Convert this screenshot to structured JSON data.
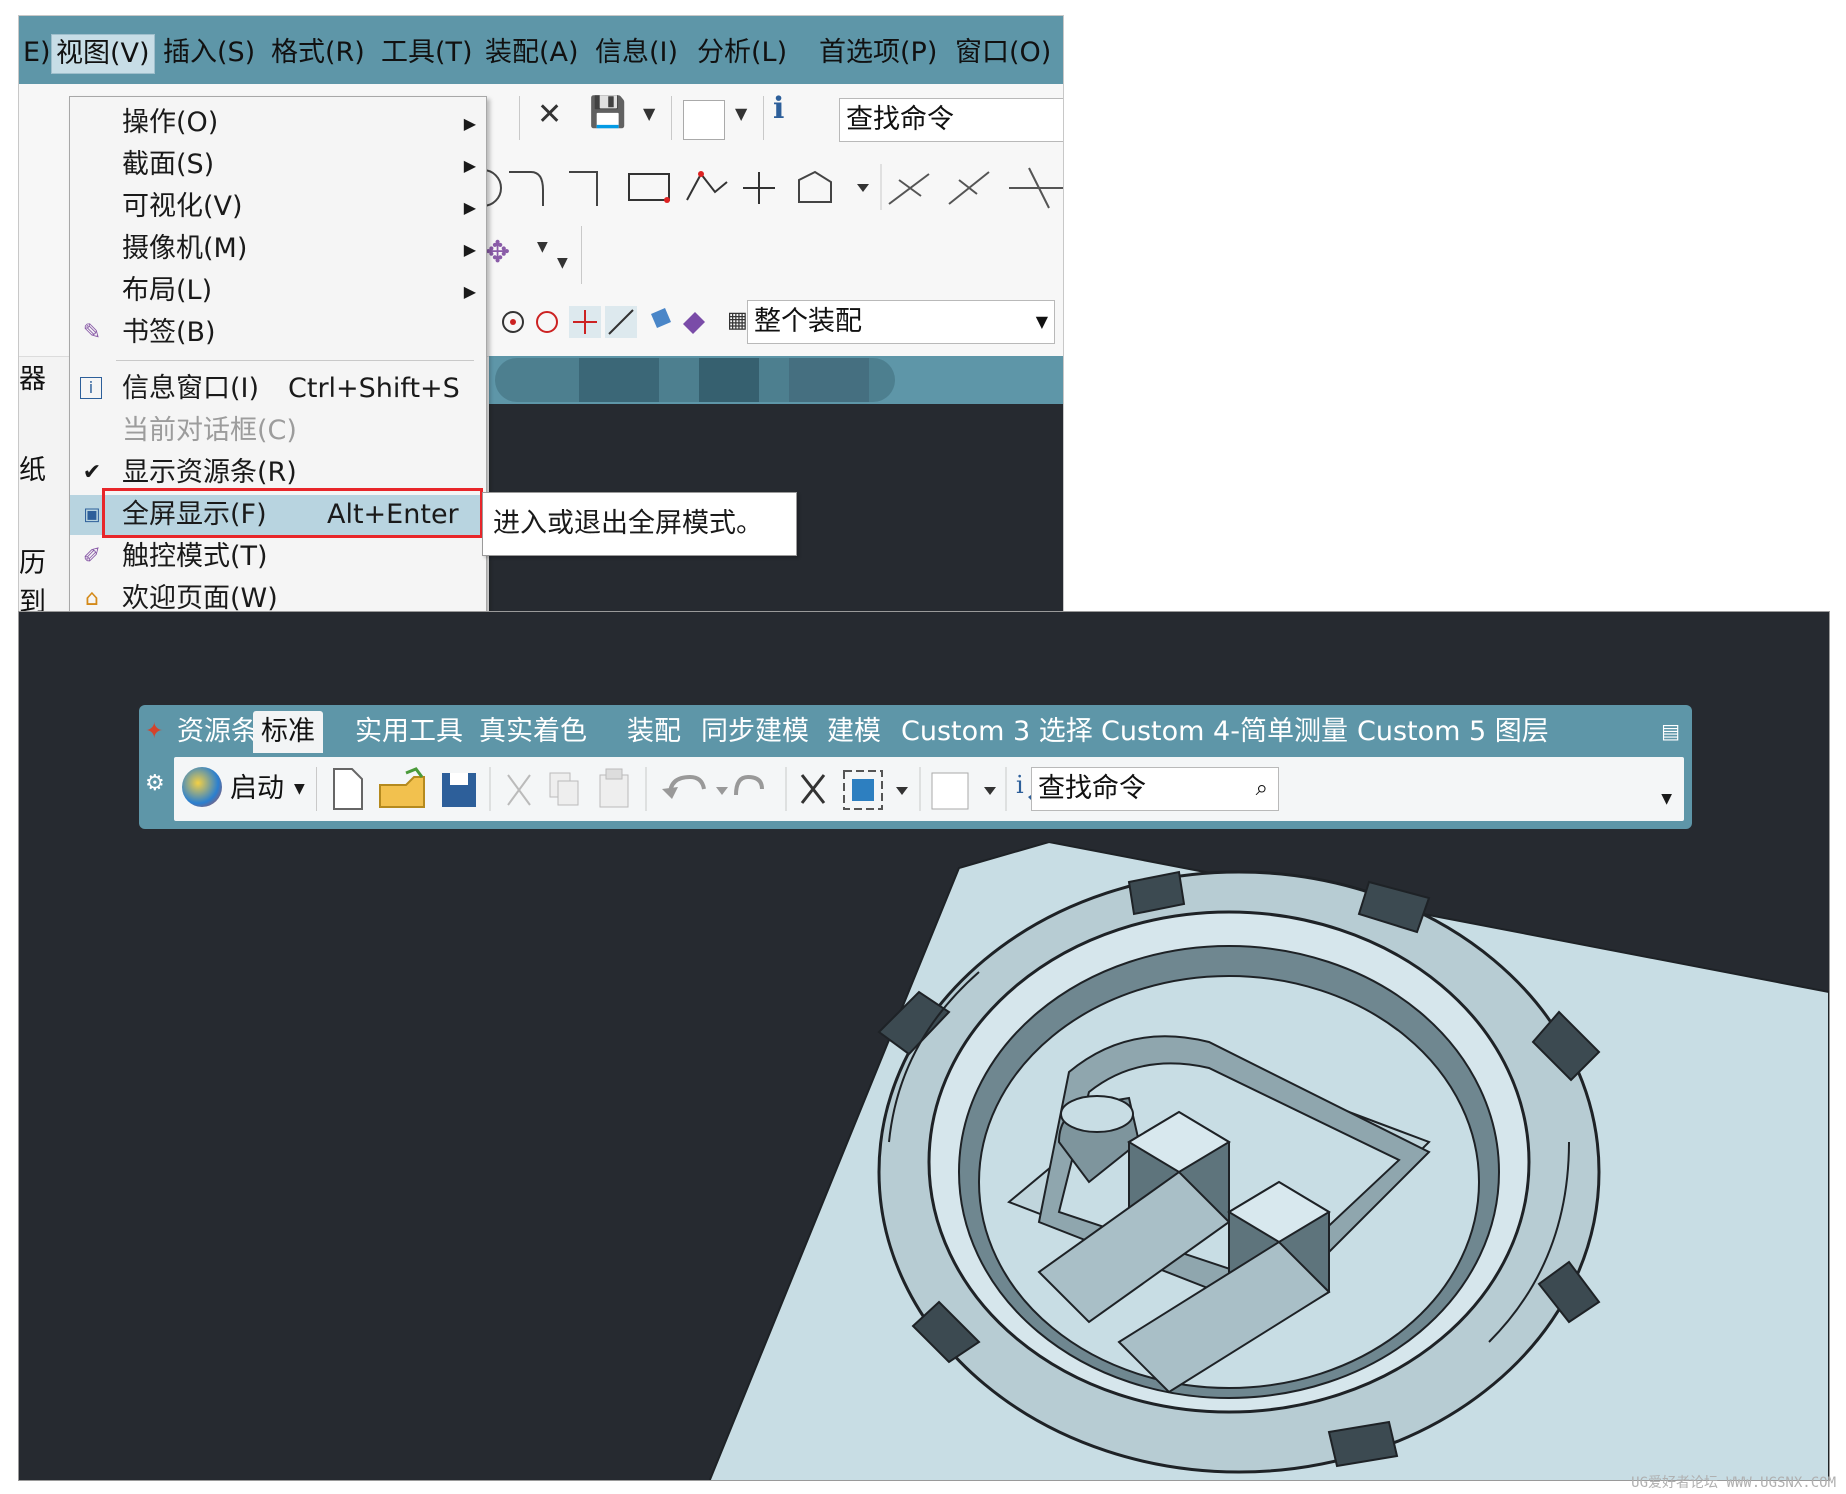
{
  "top_screenshot": {
    "menubar": {
      "items": [
        "E)",
        "视图(V)",
        "插入(S)",
        "格式(R)",
        "工具(T)",
        "装配(A)",
        "信息(I)",
        "分析(L)",
        "首选项(P)",
        "窗口(O)"
      ],
      "active": "视图(V)"
    },
    "toolbar": {
      "search_value": "查找命令",
      "scope_select": "整个装配"
    },
    "left_sliver": [
      "器",
      "纸",
      "历",
      "到"
    ],
    "view_menu": {
      "items": [
        {
          "label": "操作(O)",
          "submenu": true,
          "icon": ""
        },
        {
          "label": "截面(S)",
          "submenu": true,
          "icon": ""
        },
        {
          "label": "可视化(V)",
          "submenu": true,
          "icon": ""
        },
        {
          "label": "摄像机(M)",
          "submenu": true,
          "icon": ""
        },
        {
          "label": "布局(L)",
          "submenu": true,
          "icon": ""
        },
        {
          "label": "书签(B)",
          "submenu": false,
          "icon": "bookmark-icon"
        },
        {
          "label": "信息窗口(I)",
          "accel": "Ctrl+Shift+S",
          "icon": "info-icon"
        },
        {
          "label": "当前对话框(C)",
          "disabled": true
        },
        {
          "label": "显示资源条(R)",
          "checked": true
        },
        {
          "label": "全屏显示(F)",
          "accel": "Alt+Enter",
          "icon": "fullscreen-icon",
          "highlighted": true
        },
        {
          "label": "触控模式(T)",
          "icon": "touch-icon"
        },
        {
          "label": "欢迎页面(W)",
          "icon": "home-icon"
        }
      ]
    },
    "tooltip": "进入或退出全屏模式。"
  },
  "bottom_screenshot": {
    "tabs": [
      "资源条",
      "标准",
      "实用工具",
      "真实着色",
      "装配",
      "同步建模",
      "建模",
      "Custom 3 选择",
      "Custom 4-简单测量",
      "Custom 5 图层"
    ],
    "active_tab": "标准",
    "start_label": "启动",
    "search_value": "查找命令"
  },
  "watermark": "UG爱好者论坛 WWW.UGSNX.COM",
  "colors": {
    "ribbon": "#5e96a8",
    "canvas": "#262a30",
    "model": "#c8dde4",
    "highlight_box": "#e8262a"
  }
}
